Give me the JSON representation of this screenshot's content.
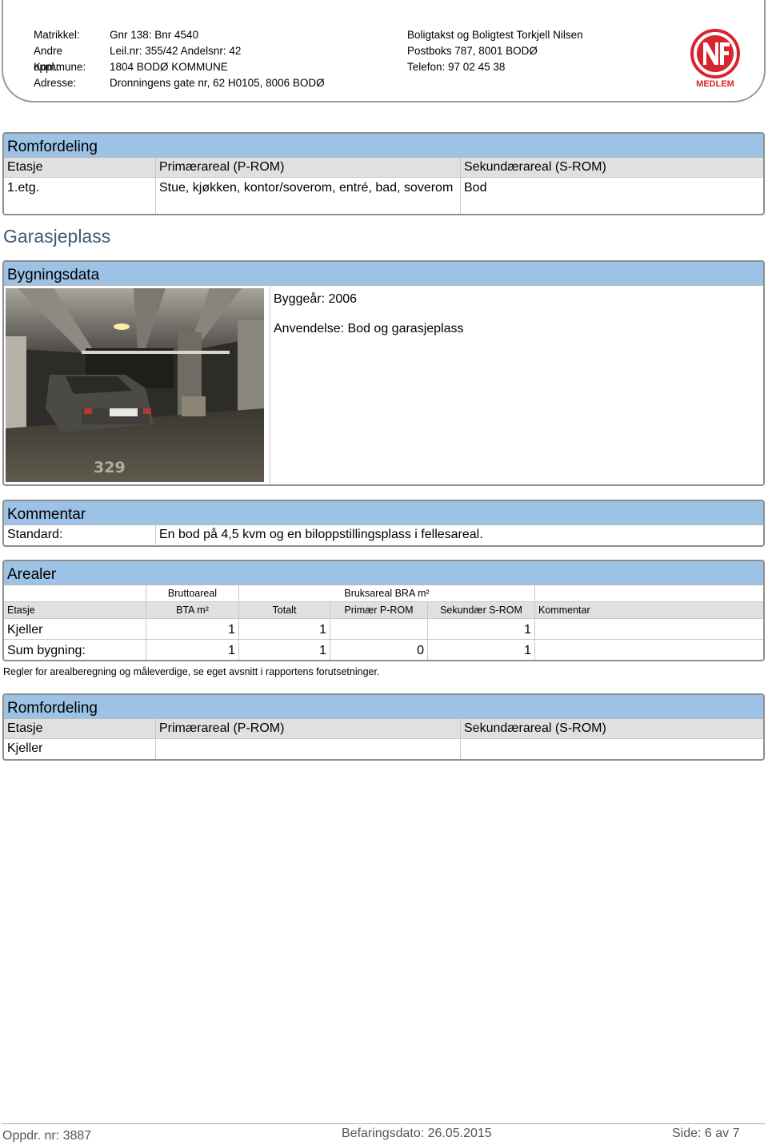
{
  "header": {
    "rows": [
      {
        "label": "Matrikkel:",
        "value": "Gnr 138: Bnr 4540"
      },
      {
        "label": "Andre oppl.:",
        "value": "Leil.nr: 355/42 Andelsnr: 42"
      },
      {
        "label": "Kommune:",
        "value": "1804 BODØ KOMMUNE"
      },
      {
        "label": "Adresse:",
        "value": "Dronningens gate nr, 62 H0105, 8006 BODØ"
      }
    ],
    "company": [
      "Boligtakst og Boligtest Torkjell Nilsen",
      "Postboks 787, 8001 BODØ",
      "Telefon: 97 02 45 38"
    ],
    "logo_text": "MEDLEM",
    "logo_color": "#d9232e"
  },
  "romfordeling1": {
    "title": "Romfordeling",
    "headers": [
      "Etasje",
      "Primærareal (P-ROM)",
      "Sekundærareal (S-ROM)"
    ],
    "row": {
      "etasje": "1.etg.",
      "primar": "Stue, kjøkken, kontor/soverom, entré, bad, soverom",
      "sekundar": "Bod"
    }
  },
  "garasjeplass_title": "Garasjeplass",
  "bygningsdata": {
    "title": "Bygningsdata",
    "byggear": "Byggeår: 2006",
    "anvendelse": "Anvendelse: Bod og garasjeplass",
    "photo_marking": "329"
  },
  "kommentar": {
    "title": "Kommentar",
    "label": "Standard:",
    "text": "En bod på 4,5 kvm og en biloppstillingsplass i fellesareal."
  },
  "arealer": {
    "title": "Arealer",
    "group_headers": {
      "brutto": "Bruttoareal",
      "bruks": "Bruksareal BRA m²"
    },
    "columns": [
      "Etasje",
      "BTA m²",
      "Totalt",
      "Primær P-ROM",
      "Sekundær S-ROM",
      "Kommentar"
    ],
    "rows": [
      {
        "etasje": "Kjeller",
        "bta": "1",
        "totalt": "1",
        "primar": "",
        "sekundar": "1",
        "kommentar": ""
      },
      {
        "etasje": "Sum bygning:",
        "bta": "1",
        "totalt": "1",
        "primar": "0",
        "sekundar": "1",
        "kommentar": ""
      }
    ],
    "note": "Regler for arealberegning og måleverdige, se eget avsnitt i rapportens forutsetninger."
  },
  "romfordeling2": {
    "title": "Romfordeling",
    "headers": [
      "Etasje",
      "Primærareal (P-ROM)",
      "Sekundærareal (S-ROM)"
    ],
    "row": {
      "etasje": "Kjeller",
      "primar": "",
      "sekundar": ""
    }
  },
  "footer": {
    "oppdrag": "Oppdr. nr: 3887",
    "befaring": "Befaringsdato: 26.05.2015",
    "side": "Side: 6 av 7"
  }
}
